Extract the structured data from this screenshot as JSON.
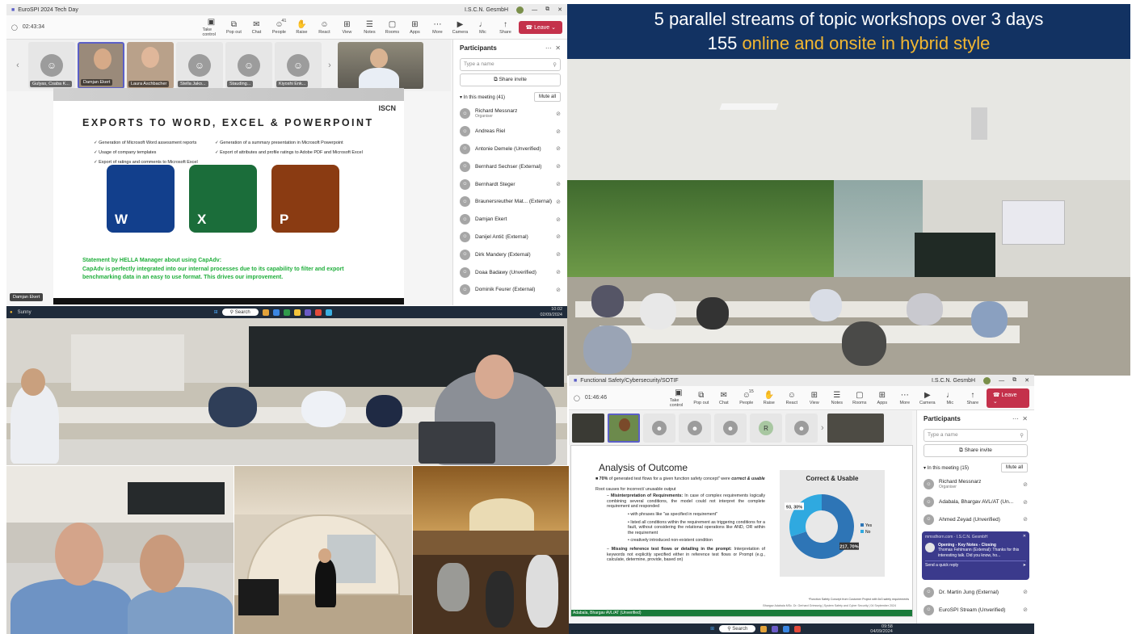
{
  "teams1": {
    "window_title": "EuroSPI 2024 Tech Day",
    "org": "I.S.C.N. GesmbH",
    "timer": "02:43:34",
    "tools": [
      {
        "label": "Take control",
        "icon": "screen-icon"
      },
      {
        "label": "Pop out",
        "icon": "popout-icon"
      },
      {
        "label": "Chat",
        "icon": "chat-icon"
      },
      {
        "label": "People",
        "icon": "people-icon",
        "badge": "41"
      },
      {
        "label": "Raise",
        "icon": "hand-icon"
      },
      {
        "label": "React",
        "icon": "smile-icon"
      },
      {
        "label": "View",
        "icon": "grid-icon"
      },
      {
        "label": "Notes",
        "icon": "notes-icon"
      },
      {
        "label": "Rooms",
        "icon": "rooms-icon"
      },
      {
        "label": "Apps",
        "icon": "apps-icon"
      },
      {
        "label": "More",
        "icon": "more-icon"
      },
      {
        "label": "Camera",
        "icon": "camera-icon"
      },
      {
        "label": "Mic",
        "icon": "mic-icon"
      },
      {
        "label": "Share",
        "icon": "share-icon"
      }
    ],
    "leave_label": "Leave",
    "thumbs": [
      "Gulyas, Csaba K...",
      "Damjan Ekert",
      "Laura Aschbacher",
      "Stella Jako...",
      "Stauding...",
      "Kiyoshi Enk..."
    ],
    "speaker_label": "Damjan Ekert",
    "participants": {
      "title": "Participants",
      "search_placeholder": "Type a name",
      "share_invite": "Share invite",
      "section": "In this meeting (41)",
      "mute_all": "Mute all",
      "list": [
        {
          "name": "Richard Messnarz",
          "sub": "Organiser"
        },
        {
          "name": "Andreas Riel",
          "sub": ""
        },
        {
          "name": "Antonie Demele (Unverified)",
          "sub": ""
        },
        {
          "name": "Bernhard Sechser (External)",
          "sub": ""
        },
        {
          "name": "Bernhardt Steger",
          "sub": ""
        },
        {
          "name": "Braunersreuther Mat... (External)",
          "sub": ""
        },
        {
          "name": "Damjan Ekert",
          "sub": ""
        },
        {
          "name": "Danijel Antič (External)",
          "sub": ""
        },
        {
          "name": "Dirk Mandery (External)",
          "sub": ""
        },
        {
          "name": "Doaa Badawy (Unverified)",
          "sub": ""
        },
        {
          "name": "Dominik Feurer (External)",
          "sub": ""
        }
      ]
    },
    "slide": {
      "logo": "ISCN",
      "title": "EXPORTS TO WORD, EXCEL & POWERPOINT",
      "bullets_left": [
        "Generation of Microsoft Word assessment reports",
        "Usage of company templates",
        "Export of ratings and comments to Microsoft Excel"
      ],
      "bullets_right": [
        "Generation of a summary presentation in Microsoft Powerpoint",
        "Export of attributes and profile ratings to Adobe PDF and Microsoft Excel"
      ],
      "tiles": [
        {
          "letter": "W",
          "color": "#123f8c"
        },
        {
          "letter": "X",
          "color": "#1b6d3a"
        },
        {
          "letter": "P",
          "color": "#8a3b12"
        }
      ],
      "statement_title": "Statement by HELLA Manager about using CapAdv:",
      "statement_body": "CapAdv is perfectly integrated into our internal processes due to its capability to filter and export benchmarking data in an easy to use format. This drives our improvement."
    }
  },
  "caption": {
    "line1": "5 parallel streams of topic workshops over 3 days",
    "line2_num": "155",
    "line2_rest": "online and onsite in hybrid style"
  },
  "taskbar1": {
    "weather": "Sunny",
    "search": "Search",
    "time": "10:02",
    "date": "02/09/2024"
  },
  "teams2": {
    "window_title": "Functional Safety/Cybersecurity/SOTIF",
    "org": "I.S.C.N. GesmbH",
    "timer": "01:46:46",
    "people_badge": "15",
    "leave_label": "Leave",
    "participants": {
      "title": "Participants",
      "search_placeholder": "Type a name",
      "share_invite": "Share invite",
      "section": "In this meeting (15)",
      "mute_all": "Mute all",
      "list": [
        {
          "name": "Richard Messnarz",
          "sub": "Organiser"
        },
        {
          "name": "Adabala, Bhargav AVL/AT (Un...",
          "sub": ""
        },
        {
          "name": "Ahmed Zeyad (Unverified)",
          "sub": ""
        }
      ],
      "more": [
        {
          "name": "Dr. Martin Jung (External)"
        },
        {
          "name": "EuroSPI Stream (Unverified)"
        }
      ]
    },
    "toast": {
      "app": "mmsdhorn.com · I.S.C.N. GesmbH",
      "title": "Opening - Key Notes - Closing",
      "body": "Thomas Fehlmann (External): Thanks for this interesting talk. Did you know, ho...",
      "reply": "Send a quick reply"
    },
    "slide": {
      "title": "Analysis of Outcome",
      "bullet1_bold": "70%",
      "bullet1_text": "of generated test flows for a given function safety concept\" were",
      "bullet1_em": "correct & usable",
      "bullet2": "Root causes for incorrect/ unusable output",
      "sub1_bold": "Misinterpretation of Requirements:",
      "sub1_text": "In case of complex requirements logically combining several conditions, the model could not interpret the complete requirement and responded",
      "subsub": [
        "with phrases like \"as specified in requirement\"",
        "listed all conditions within the requirement as triggering conditions for a fault, without considering the relational operations like AND, OR within the requirement",
        "creatively introduced non-existent condition"
      ],
      "sub2_bold": "Missing reference test flows or detailing in the prompt:",
      "sub2_text": "Interpretation of keywords not explicitly specified either in reference test flows or Prompt (e.g., calculate, determine, provide, based on)",
      "footnote": "*Function Safety Concept from Customer Project with 6x3 safety requirements",
      "footer": "Bhargav Adabala MSc. Dr. Gerhard Griessnig | System Safety and Cyber Security | 04 September 2024",
      "presenter": "Adabala, Bhargav AVL/AT (Unverified)"
    }
  },
  "chart_data": {
    "type": "pie",
    "title": "Correct & Usable",
    "categories": [
      "Yes",
      "No"
    ],
    "values": [
      217,
      93
    ],
    "data_labels": [
      "217, 70%",
      "93, 30%"
    ],
    "colors": {
      "Yes": "#2e75b6",
      "No": "#2fa9e0"
    },
    "legend": "right"
  },
  "taskbar2": {
    "search": "Search",
    "time": "09:58",
    "date": "04/09/2024"
  }
}
